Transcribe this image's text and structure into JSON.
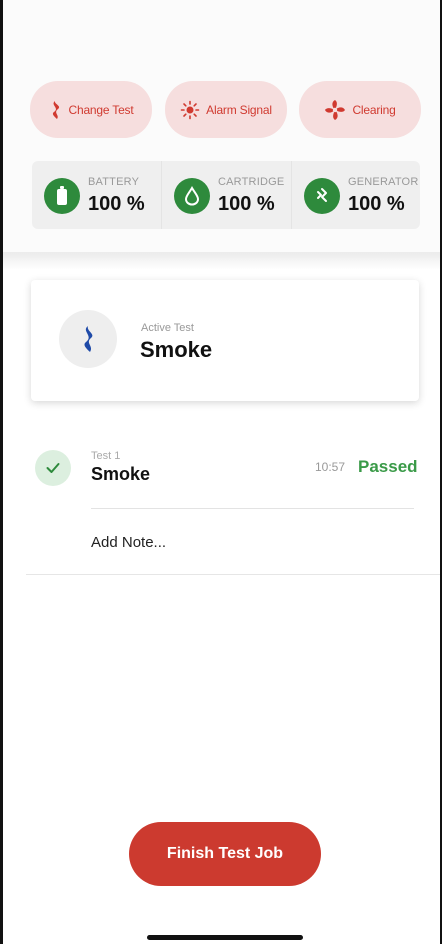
{
  "actions": [
    {
      "label": "Change Test",
      "icon": "smoke-icon"
    },
    {
      "label": "Alarm Signal",
      "icon": "alarm-sun-icon"
    },
    {
      "label": "Clearing",
      "icon": "fan-icon"
    }
  ],
  "status": [
    {
      "label": "BATTERY",
      "value": "100 %",
      "icon": "battery-icon"
    },
    {
      "label": "CARTRIDGE",
      "value": "100 %",
      "icon": "drop-icon"
    },
    {
      "label": "GENERATOR",
      "value": "100 %",
      "icon": "generator-icon"
    }
  ],
  "active_test": {
    "label": "Active Test",
    "value": "Smoke",
    "icon": "smoke-icon"
  },
  "test_entry": {
    "label": "Test 1",
    "name": "Smoke",
    "time": "10:57",
    "status": "Passed",
    "icon": "check-icon"
  },
  "add_note": "Add Note...",
  "finish_button": "Finish Test Job",
  "colors": {
    "accent": "#cc3a2f",
    "success": "#2e8a3c",
    "pill_bg": "#f6dede",
    "smoke_blue": "#1f4aa8"
  }
}
